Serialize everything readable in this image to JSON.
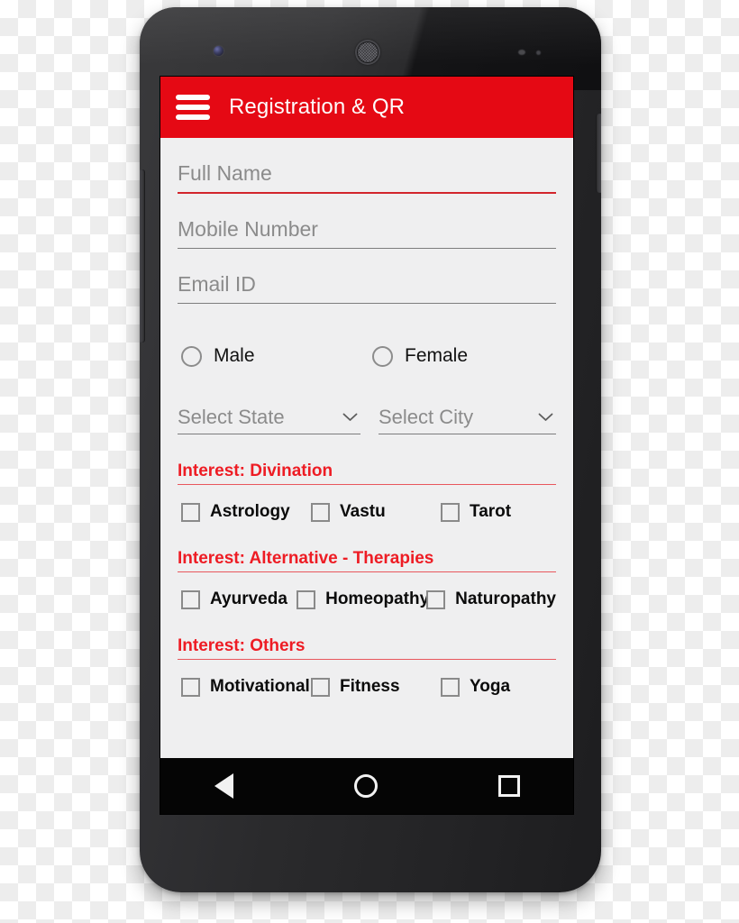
{
  "device": {
    "name": "android-smartphone-mockup",
    "hardware": {
      "front_camera": "front-camera",
      "earpiece": "earpiece-speaker",
      "volume_rocker": "volume-rocker-button",
      "power_button": "power-button"
    }
  },
  "appbar": {
    "menu_icon": "hamburger-menu-icon",
    "title": "Registration & QR",
    "background_color": "#e50914",
    "text_color": "#ffffff"
  },
  "form": {
    "fields": [
      {
        "name": "full-name",
        "placeholder": "Full Name",
        "value": "",
        "underline": "red"
      },
      {
        "name": "mobile-number",
        "placeholder": "Mobile Number",
        "value": "",
        "underline": "gray"
      },
      {
        "name": "email-id",
        "placeholder": "Email ID",
        "value": "",
        "underline": "gray"
      }
    ],
    "gender": {
      "options": [
        {
          "label": "Male",
          "selected": false
        },
        {
          "label": "Female",
          "selected": false
        }
      ]
    },
    "selects": [
      {
        "name": "select-state",
        "value": "Select State",
        "icon": "chevron-down-icon"
      },
      {
        "name": "select-city",
        "value": "Select City",
        "icon": "chevron-down-icon"
      }
    ],
    "interest_sections": [
      {
        "heading": "Interest: Divination",
        "options": [
          {
            "label": "Astrology",
            "checked": false
          },
          {
            "label": "Vastu",
            "checked": false
          },
          {
            "label": "Tarot",
            "checked": false
          }
        ]
      },
      {
        "heading": "Interest: Alternative - Therapies",
        "options": [
          {
            "label": "Ayurveda",
            "checked": false
          },
          {
            "label": "Homeopathy",
            "checked": false
          },
          {
            "label": "Naturopathy",
            "checked": false
          }
        ]
      },
      {
        "heading": "Interest: Others",
        "options": [
          {
            "label": "Motivational",
            "checked": false
          },
          {
            "label": "Fitness",
            "checked": false
          },
          {
            "label": "Yoga",
            "checked": false
          }
        ]
      }
    ],
    "heading_color": "#ee1c24",
    "background_color": "#efeff0"
  },
  "navbar": {
    "buttons": [
      {
        "name": "nav-back-button",
        "icon": "triangle-back-icon"
      },
      {
        "name": "nav-home-button",
        "icon": "circle-home-icon"
      },
      {
        "name": "nav-recents-button",
        "icon": "square-recents-icon"
      }
    ],
    "background_color": "#050505"
  }
}
